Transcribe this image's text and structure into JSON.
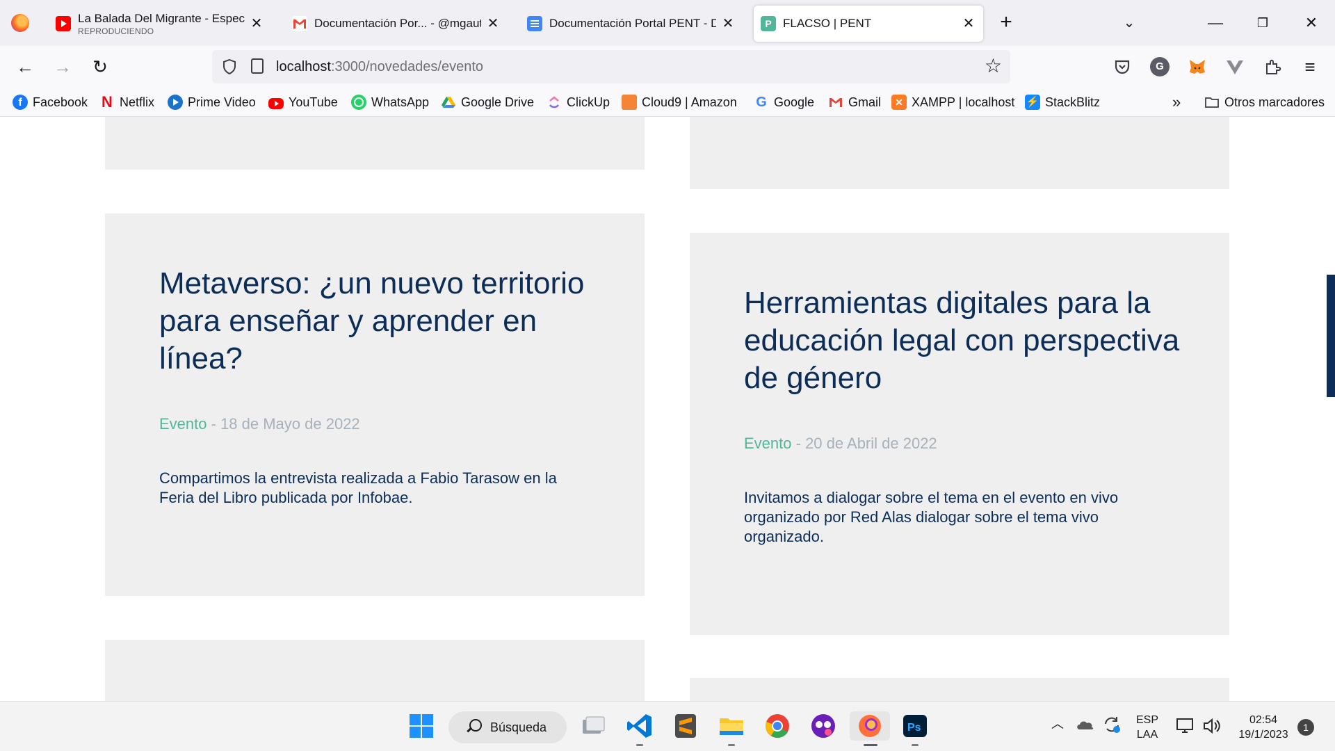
{
  "browser": {
    "tabs": [
      {
        "title": "La Balada Del Migrante - Especi",
        "subtitle": "REPRODUCIENDO",
        "favicon": "youtube-icon"
      },
      {
        "title": "Documentación Por... - @mgaut",
        "favicon": "gmail-icon"
      },
      {
        "title": "Documentación Portal PENT - D",
        "favicon": "google-docs-icon"
      },
      {
        "title": "FLACSO | PENT",
        "favicon": "pent-icon",
        "active": true
      }
    ],
    "new_tab_label": "+",
    "url": {
      "host": "localhost",
      "path": ":3000/novedades/evento"
    },
    "bookmarks": [
      {
        "label": "Facebook",
        "icon": "facebook-icon",
        "color": "#1877f2"
      },
      {
        "label": "Netflix",
        "icon": "netflix-icon",
        "color": "#e50914"
      },
      {
        "label": "Prime Video",
        "icon": "prime-video-icon",
        "color": "#1a73c8"
      },
      {
        "label": "YouTube",
        "icon": "youtube-icon",
        "color": "#ff0000"
      },
      {
        "label": "WhatsApp",
        "icon": "whatsapp-icon",
        "color": "#25d366"
      },
      {
        "label": "Google Drive",
        "icon": "google-drive-icon",
        "color": "#1fa463"
      },
      {
        "label": "ClickUp",
        "icon": "clickup-icon",
        "color": "#7b68ee"
      },
      {
        "label": "Cloud9 | Amazon",
        "icon": "aws-icon",
        "color": "#f58536"
      },
      {
        "label": "Google",
        "icon": "google-icon",
        "color": "#4285f4"
      },
      {
        "label": "Gmail",
        "icon": "gmail-icon",
        "color": "#ea4335"
      },
      {
        "label": "XAMPP | localhost",
        "icon": "xampp-icon",
        "color": "#fb7a24"
      },
      {
        "label": "StackBlitz",
        "icon": "stackblitz-icon",
        "color": "#1389fd"
      }
    ],
    "other_bookmarks_label": "Otros marcadores"
  },
  "page": {
    "cards": [
      {
        "title": "Metaverso: ¿un nuevo territorio para enseñar y aprender en línea?",
        "category": "Evento",
        "separator": " - ",
        "date": "18 de Mayo de 2022",
        "summary": "Compartimos la entrevista realizada a Fabio Tarasow en la Feria del Libro publicada por Infobae."
      },
      {
        "title": "Herramientas digitales para la educación legal con perspectiva de género",
        "category": "Evento",
        "separator": " - ",
        "date": "20 de Abril de 2022",
        "summary": "Invitamos a dialogar sobre el tema en el evento en vivo organizado por Red Alas dialogar sobre el tema vivo organizado."
      }
    ],
    "colors": {
      "title": "#0c2d57",
      "category": "#52b69a",
      "date": "#a8b0b9",
      "card_bg": "#efeff0"
    }
  },
  "taskbar": {
    "search_label": "Búsqueda",
    "apps": [
      "windows-start-icon",
      "task-view-icon",
      "vscode-icon",
      "sublime-text-icon",
      "file-explorer-icon",
      "chrome-icon",
      "app-icon",
      "firefox-icon",
      "photoshop-icon"
    ],
    "language": {
      "line1": "ESP",
      "line2": "LAA"
    },
    "clock": {
      "time": "02:54",
      "date": "19/1/2023"
    },
    "notifications": "1"
  }
}
